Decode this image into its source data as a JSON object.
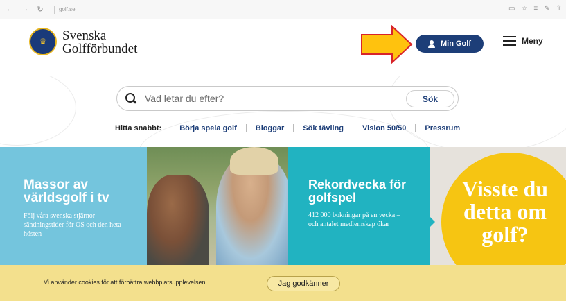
{
  "browser": {
    "url": "golf.se",
    "back_glyph": "←",
    "forward_glyph": "→",
    "refresh_glyph": "↻"
  },
  "header": {
    "logo_line1": "Svenska",
    "logo_line2": "Golfförbundet",
    "min_golf_label": "Min Golf",
    "menu_label": "Meny",
    "brand_color": "#1d3e78",
    "arrow_color": "#ffc20e"
  },
  "search": {
    "placeholder": "Vad letar du efter?",
    "button_label": "Sök"
  },
  "quick_links": {
    "label": "Hitta snabbt:",
    "items": [
      "Börja spela golf",
      "Bloggar",
      "Sök tävling",
      "Vision 50/50",
      "Pressrum"
    ]
  },
  "banner": {
    "panel1": {
      "title": "Massor av världsgolf i tv",
      "text": "Följ våra svenska stjärnor – sändningstider för OS och den heta hösten",
      "color": "#74c5dd"
    },
    "panel3": {
      "title": "Rekordvecka för golfspel",
      "text": "412 000 bokningar på en vecka – och antalet medlemskap ökar",
      "color": "#21b3c1"
    },
    "panel4": {
      "title": "Visste du detta om golf?",
      "color": "#f6c512"
    }
  },
  "cookie": {
    "message": "Vi använder cookies för att förbättra webbplatsupplevelsen.",
    "accept_label": "Jag godkänner"
  }
}
